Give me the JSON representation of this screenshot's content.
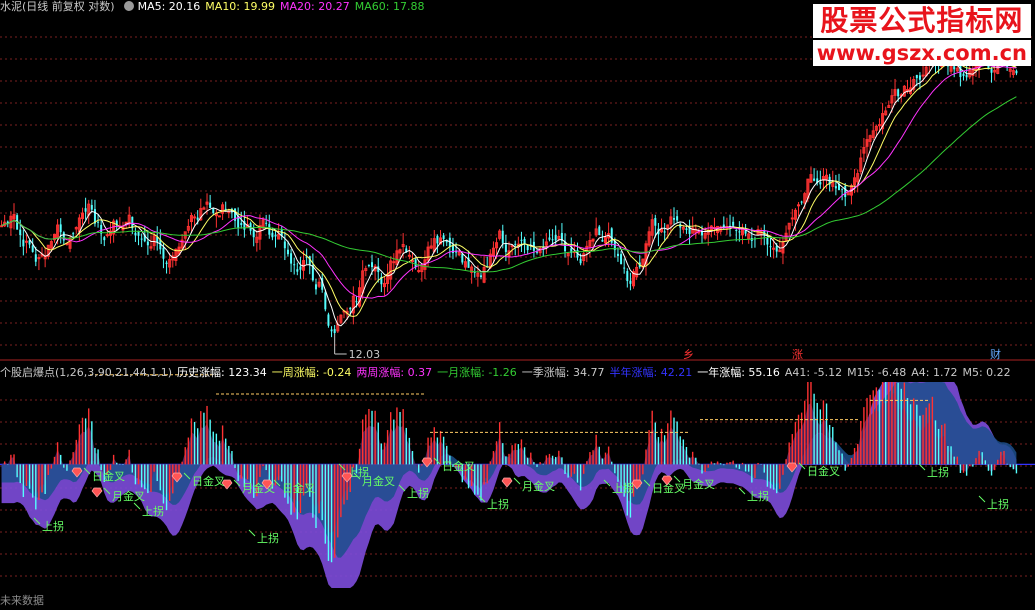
{
  "header": {
    "title": "水泥(日线 前复权 对数)",
    "ma": [
      {
        "label": "MA5: 20.16",
        "color": "#ffffff"
      },
      {
        "label": "MA10: 19.99",
        "color": "#ffff66"
      },
      {
        "label": "MA20: 20.27",
        "color": "#ff33ff"
      },
      {
        "label": "MA60: 17.88",
        "color": "#33cc33"
      }
    ]
  },
  "watermark": {
    "title": "股票公式指标网",
    "url": "www.gszx.com.cn"
  },
  "indicator_header": [
    {
      "text": "个股启爆点(1,26,3,90,21,44,1,1)",
      "color": "#c8c8c8"
    },
    {
      "text": "历史涨幅: 123.34",
      "color": "#ffffff"
    },
    {
      "text": "一周涨幅: -0.24",
      "color": "#ffff66"
    },
    {
      "text": "两周涨幅: 0.37",
      "color": "#ff33ff"
    },
    {
      "text": "一月涨幅: -1.26",
      "color": "#33cc33"
    },
    {
      "text": "一季涨幅: 34.77",
      "color": "#c8c8c8"
    },
    {
      "text": "半年涨幅: 42.21",
      "color": "#3333ff"
    },
    {
      "text": "一年涨幅: 55.16",
      "color": "#ffffff"
    },
    {
      "text": "A41: -5.12",
      "color": "#c8c8c8"
    },
    {
      "text": "M15: -6.48",
      "color": "#c8c8c8"
    },
    {
      "text": "A4: 1.72",
      "color": "#c8c8c8"
    },
    {
      "text": "M5: 0.22",
      "color": "#c8c8c8"
    }
  ],
  "markers": {
    "low_label": "12.03",
    "event_1": "乡",
    "event_2": "涨",
    "event_3": "财"
  },
  "signal_labels": [
    {
      "text": "上拐",
      "kind": "up"
    },
    {
      "text": "日金叉",
      "kind": "cross"
    },
    {
      "text": "月金叉",
      "kind": "cross"
    },
    {
      "text": "上拐",
      "kind": "up"
    },
    {
      "text": "日金叉",
      "kind": "cross"
    },
    {
      "text": "月金叉",
      "kind": "cross"
    },
    {
      "text": "上拐",
      "kind": "up"
    },
    {
      "text": "日金叉",
      "kind": "cross"
    },
    {
      "text": "上拐",
      "kind": "up"
    },
    {
      "text": "月金叉",
      "kind": "cross"
    },
    {
      "text": "上拐",
      "kind": "up"
    },
    {
      "text": "日金叉",
      "kind": "cross"
    },
    {
      "text": "上拐",
      "kind": "up"
    },
    {
      "text": "月金叉",
      "kind": "cross"
    },
    {
      "text": "上拐",
      "kind": "up"
    },
    {
      "text": "日金叉",
      "kind": "cross"
    },
    {
      "text": "月金叉",
      "kind": "cross"
    },
    {
      "text": "上拐",
      "kind": "up"
    },
    {
      "text": "日金叉",
      "kind": "cross"
    },
    {
      "text": "上拐",
      "kind": "up"
    },
    {
      "text": "上拐",
      "kind": "up"
    }
  ],
  "footer": "未来数据",
  "colors": {
    "up": "#ff3232",
    "down": "#54ffff",
    "ma5": "#ffffff",
    "ma10": "#ffff66",
    "ma20": "#ff33ff",
    "ma60": "#33cc33",
    "grid": "#7a1f1f",
    "dash": "#ffcc66"
  },
  "chart_data": {
    "type": "candlestick",
    "scale": "log",
    "price_range": [
      12.03,
      22.5
    ],
    "indicator_range": [
      -30,
      20
    ],
    "closes": [
      15.2,
      15.3,
      15.26,
      15.47,
      15.52,
      15.09,
      14.94,
      14.63,
      14.77,
      14.68,
      14.48,
      14.22,
      14.33,
      14.42,
      14.36,
      14.66,
      14.76,
      14.96,
      15.22,
      15.02,
      14.79,
      14.71,
      14.86,
      14.97,
      15.15,
      15.42,
      15.56,
      15.6,
      15.82,
      15.66,
      15.26,
      15.29,
      14.98,
      14.8,
      14.95,
      15.05,
      15.33,
      15.21,
      15.19,
      15.18,
      15.3,
      15.5,
      15.13,
      14.93,
      14.92,
      14.84,
      14.77,
      14.66,
      14.62,
      14.92,
      14.74,
      14.55,
      14.3,
      14.16,
      14.28,
      14.37,
      14.55,
      14.61,
      14.8,
      15.03,
      15.18,
      15.49,
      15.45,
      15.37,
      15.69,
      15.71,
      15.88,
      15.71,
      15.56,
      15.56,
      15.48,
      15.8,
      15.65,
      15.6,
      15.58,
      15.34,
      15.15,
      15.22,
      15.09,
      15.23,
      15.06,
      14.88,
      14.88,
      15.2,
      15.37,
      15.28,
      14.95,
      14.88,
      14.9,
      14.96,
      14.91,
      14.58,
      14.42,
      14.17,
      14.14,
      13.96,
      14.01,
      14.25,
      14.34,
      14.14,
      13.74,
      13.51,
      13.69,
      13.5,
      13.02,
      12.63,
      12.5,
      12.46,
      12.67,
      12.88,
      12.98,
      12.97,
      13.02,
      13.34,
      13.21,
      13.55,
      13.98,
      14.04,
      14.11,
      14.08,
      14.1,
      13.95,
      13.64,
      13.66,
      13.89,
      14.24,
      14.22,
      14.51,
      14.54,
      14.68,
      14.47,
      14.39,
      14.25,
      14.08,
      13.99,
      14.13,
      14.27,
      14.61,
      14.64,
      14.84,
      14.71,
      14.86,
      14.83,
      14.74,
      14.62,
      14.45,
      14.47,
      14.47,
      14.2,
      14.22,
      14.06,
      14.08,
      13.93,
      13.92,
      13.82,
      14.07,
      14.08,
      14.42,
      14.58,
      14.73,
      15.05,
      14.71,
      14.48,
      14.51,
      14.65,
      14.69,
      14.69,
      14.78,
      14.68,
      14.53,
      14.64,
      14.51,
      14.46,
      14.57,
      14.58,
      14.75,
      14.81,
      14.8,
      14.79,
      14.9,
      14.78,
      14.5,
      14.44,
      14.45,
      14.49,
      14.33,
      14.18,
      14.43,
      14.63,
      14.79,
      14.83,
      15.11,
      14.94,
      14.76,
      14.87,
      14.98,
      14.73,
      14.53,
      14.37,
      14.16,
      14.06,
      13.72,
      13.65,
      13.96,
      14.07,
      14.08,
      14.29,
      14.7,
      15.03,
      15.37,
      15.2,
      14.96,
      15.1,
      15.01,
      15.22,
      15.45,
      15.37,
      15.35,
      15.15,
      15.15,
      15.08,
      14.97,
      15.14,
      15.1,
      15.05,
      14.93,
      14.99,
      15.08,
      15.19,
      15.15,
      15.18,
      15.16,
      15.13,
      15.18,
      15.19,
      15.2,
      15.07,
      15.03,
      15.13,
      14.98,
      14.97,
      14.78,
      14.84,
      15.09,
      15.06,
      14.93,
      14.68,
      14.63,
      14.58,
      14.49,
      14.53,
      14.74,
      14.99,
      15.27,
      15.42,
      15.64,
      15.8,
      15.88,
      16.13,
      16.57,
      16.71,
      16.52,
      16.45,
      16.41,
      16.65,
      16.69,
      16.41,
      16.47,
      16.29,
      16.24,
      16.27,
      16.03,
      16.16,
      16.37,
      16.61,
      16.74,
      17.23,
      17.57,
      17.83,
      17.96,
      18.12,
      18.27,
      18.33,
      18.71,
      18.8,
      18.99,
      19.34,
      19.56,
      19.32,
      19.37,
      19.68,
      19.56,
      19.62,
      19.93,
      19.98,
      19.92,
      20.09,
      20.39,
      20.63,
      20.93,
      20.55,
      20.48,
      20.69,
      20.83,
      20.42,
      20.49,
      20.31,
      20.35,
      20.02,
      20.06,
      20.01,
      20.26,
      20.28,
      20.5,
      20.7,
      20.71,
      20.55,
      20.31,
      20.18,
      20.27,
      20.5,
      20.69,
      20.71,
      20.4,
      20.32,
      20.26,
      20.16
    ]
  }
}
